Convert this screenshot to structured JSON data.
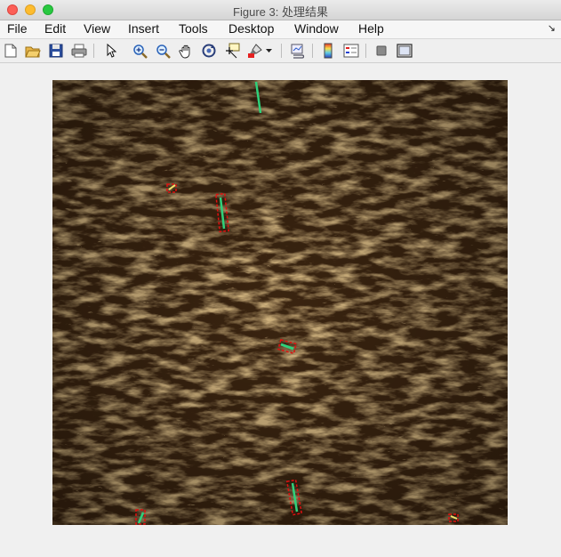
{
  "window": {
    "title": "Figure 3: 处理结果"
  },
  "menu": {
    "file": "File",
    "edit": "Edit",
    "view": "View",
    "insert": "Insert",
    "tools": "Tools",
    "desktop": "Desktop",
    "window": "Window",
    "help": "Help"
  },
  "toolbar": {
    "icons": [
      "new-figure",
      "open-file",
      "save-figure",
      "print-figure",
      "edit-plot",
      "zoom-in",
      "zoom-out",
      "pan",
      "rotate-3d",
      "data-cursor",
      "brush",
      "brush-dropdown",
      "link-plot",
      "insert-colorbar",
      "insert-legend",
      "hide-plot-tools",
      "show-plot-tools"
    ]
  },
  "colors": {
    "texture_base": "#3a2410",
    "texture_light": "#a87a3a",
    "detection_box": "#e01010",
    "detection_line": "#2fd17a"
  }
}
